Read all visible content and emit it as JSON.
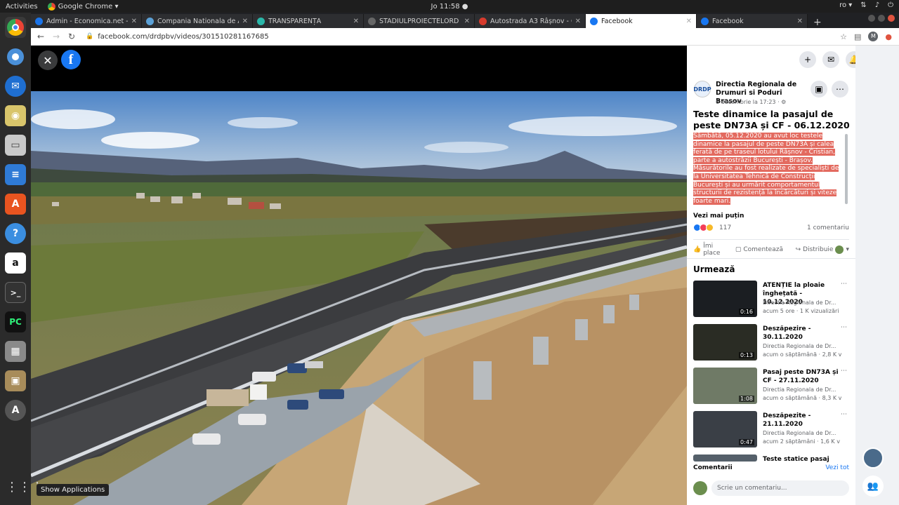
{
  "os": {
    "activities": "Activities",
    "app_menu": "Google Chrome ▾",
    "clock": "Jo 11:58 ●",
    "lang": "ro ▾",
    "tray": [
      "network-icon",
      "volume-icon",
      "power-icon"
    ]
  },
  "dock": {
    "items": [
      "chrome-icon",
      "chromium-icon",
      "thunderbird-icon",
      "rhythmbox-icon",
      "files-icon",
      "writer-icon",
      "software-center-icon",
      "help-icon",
      "amazon-icon",
      "terminal-icon",
      "pycharm-icon",
      "calculator-icon",
      "archive-icon",
      "update-icon"
    ],
    "show_apps_tooltip": "Show Applications"
  },
  "browser": {
    "tabs": [
      {
        "label": "Admin - Economica.net -",
        "fav": "#1a73e8",
        "active": false
      },
      {
        "label": "Compania Nationala de A",
        "fav": "#5ba0d6",
        "active": false
      },
      {
        "label": "TRANSPARENȚĂ",
        "fav": "#2ab7a9",
        "active": false
      },
      {
        "label": "STADIULPROIECTELORD",
        "fav": "#666666",
        "active": false
      },
      {
        "label": "Autostrada A3 Râșnov - C",
        "fav": "#d73b2d",
        "active": false
      },
      {
        "label": "Facebook",
        "fav": "#1877f2",
        "active": true
      },
      {
        "label": "Facebook",
        "fav": "#1877f2",
        "active": false
      }
    ],
    "new_tab": "+",
    "url": "facebook.com/drdpbv/videos/301510281167685"
  },
  "post": {
    "page_name": "Directia Regionala de Drumuri si Poduri Brasov",
    "logo_text": "DRDP",
    "date": "6 decembrie la 17:23 · ⚙",
    "title": "Teste dinamice la pasajul de peste DN73A și CF - 06.12.2020",
    "body": "Sâmbătă, 05.12.2020 au avut loc testele dinamice la pasajul de peste DN73A și calea ferată de pe traseul lotului Râșnov - Cristian, parte a autostrăzii București - Brașov. Măsurătorile au fost realizate de specialiști de la Universitatea Tehnică de Construcții București și au urmărit comportamentul structurii de rezistență la încărcături și viteze foarte mari.",
    "see_less": "Vezi mai puțin",
    "reactions_count": "117",
    "comments_count": "1 comentariu",
    "like_label": "Îmi place",
    "comment_label": "Comentează",
    "share_label": "Distribuie"
  },
  "up_next": {
    "heading": "Urmează",
    "videos": [
      {
        "title": "ATENȚIE la ploaie înghețată - 10.12.2020",
        "page": "Directia Regionala de Dr...",
        "meta": "acum 5 ore · 1 K vizualizări",
        "duration": "0:16"
      },
      {
        "title": "Deszăpezire - 30.11.2020",
        "page": "Directia Regionala de Dr...",
        "meta": "acum o săptămână · 2,8 K v",
        "duration": "0:13"
      },
      {
        "title": "Pasaj peste DN73A și CF - 27.11.2020",
        "page": "Directia Regionala de Dr...",
        "meta": "acum o săptămână · 8,3 K v",
        "duration": "1:08"
      },
      {
        "title": "Deszăpezite - 21.11.2020",
        "page": "Directia Regionala de Dr...",
        "meta": "acum 2 săptămâni · 1,6 K v",
        "duration": "0:47"
      },
      {
        "title": "Teste statice pasaj",
        "page": "",
        "meta": "",
        "duration": ""
      }
    ]
  },
  "comments": {
    "heading": "Comentarii",
    "sort": "Vezi tot",
    "placeholder": "Scrie un comentariu..."
  },
  "colors": {
    "facebook_blue": "#1877f2",
    "highlight": "#e36a5f"
  }
}
